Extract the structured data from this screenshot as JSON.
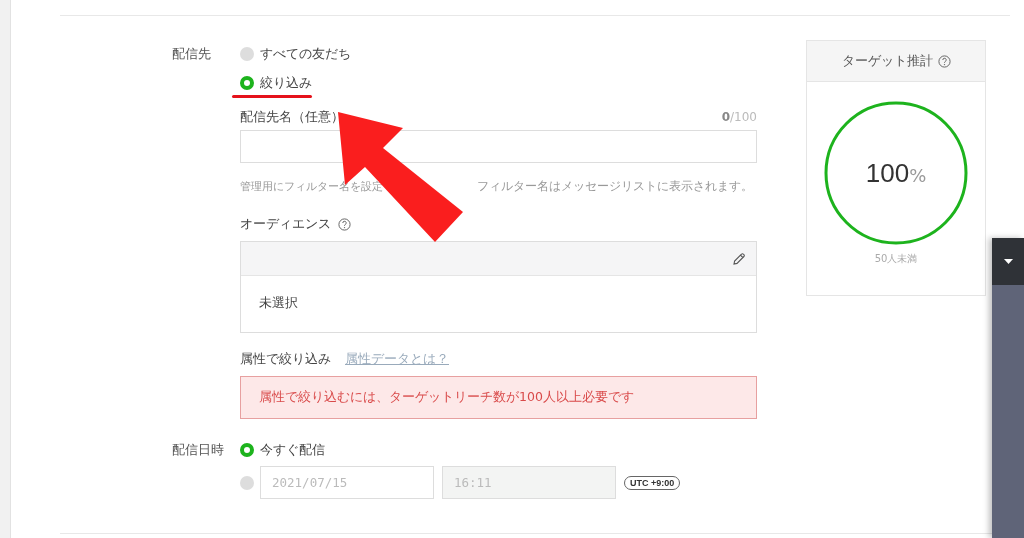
{
  "recipient": {
    "label": "配信先",
    "options": [
      {
        "label": "すべての友だち",
        "selected": false
      },
      {
        "label": "絞り込み",
        "selected": true
      }
    ]
  },
  "name_field": {
    "label": "配信先名（任意）",
    "counter": "**0**/100",
    "hint_parts": [
      "管理用にフィルター名を設定",
      "フィルター名はメッセージリストに表示されます。"
    ]
  },
  "audience": {
    "label": "オーディエンス",
    "value": "未選択"
  },
  "attribute_filter": {
    "label": "属性で絞り込み",
    "link": "属性データとは？",
    "error": "属性で絞り込むには、ターゲットリーチ数が100人以上必要です"
  },
  "schedule": {
    "label": "配信日時",
    "options": [
      {
        "kind": "now",
        "label": "今すぐ配信",
        "selected": true
      },
      {
        "kind": "datetime",
        "selected": false,
        "date": "2021/07/15",
        "time": "16:11",
        "timezone": "UTC +9:00"
      }
    ]
  },
  "target": {
    "title": "ターゲット推計",
    "level": 1,
    "value": "100",
    "unit": "%",
    "note": "50人未満"
  }
}
